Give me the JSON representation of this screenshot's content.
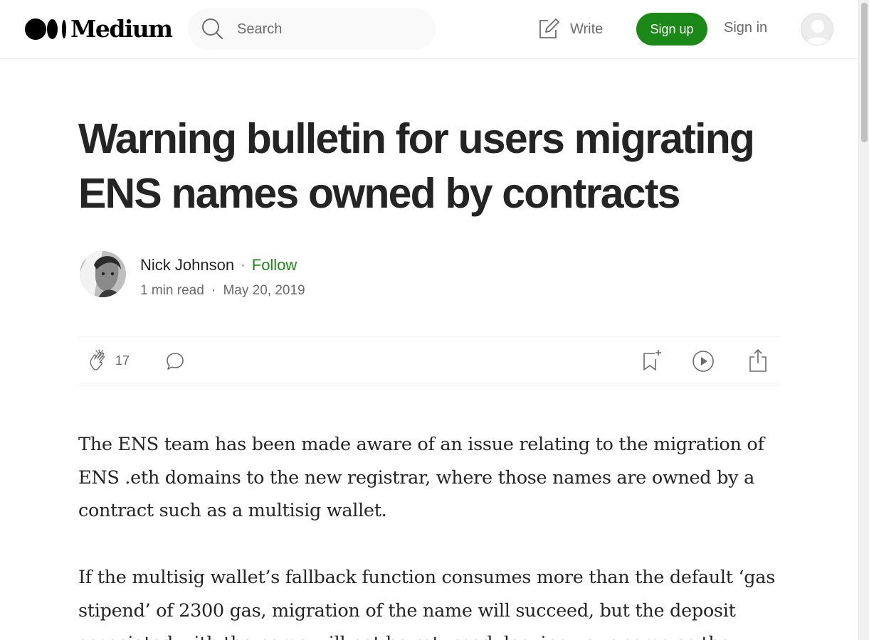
{
  "header": {
    "logo_text": "Medium",
    "search_placeholder": "Search",
    "write_label": "Write",
    "signup_label": "Sign up",
    "signin_label": "Sign in"
  },
  "article": {
    "title": "Warning bulletin for users migrating ENS names owned by contracts",
    "author": "Nick Johnson",
    "separator": "·",
    "follow_label": "Follow",
    "read_time": "1 min read",
    "date": "May 20, 2019",
    "clap_count": "17",
    "paragraphs": [
      "The ENS team has been made aware of an issue relating to the migration of ENS .eth domains to the new registrar, where those names are owned by a contract such as a multisig wallet.",
      "If the multisig wallet’s fallback function consumes more than the default ‘gas stipend’ of 2300 gas, migration of the name will succeed, but the deposit associated with the name will not be returned, leaving your name as the"
    ]
  },
  "colors": {
    "accent_green": "#1a8917",
    "text": "#242424",
    "muted": "#6b6b6b"
  },
  "icons": [
    "medium-logo-icon",
    "search-icon",
    "write-icon",
    "user-avatar-icon",
    "clap-icon",
    "comment-icon",
    "bookmark-icon",
    "play-icon",
    "share-icon"
  ]
}
